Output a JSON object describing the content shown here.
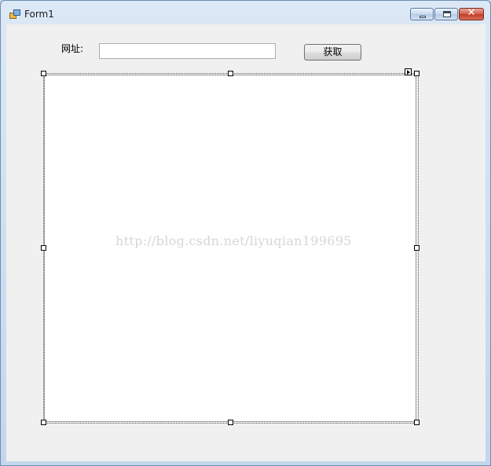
{
  "window": {
    "title": "Form1",
    "icon": "form-icon",
    "controls": [
      "minimize-icon",
      "maximize-icon",
      "close-icon"
    ]
  },
  "form": {
    "url_label": "网址:",
    "url_value": "",
    "get_button_label": "获取"
  },
  "browser": {
    "watermark": "http://blog.csdn.net/liyuqian199695"
  }
}
